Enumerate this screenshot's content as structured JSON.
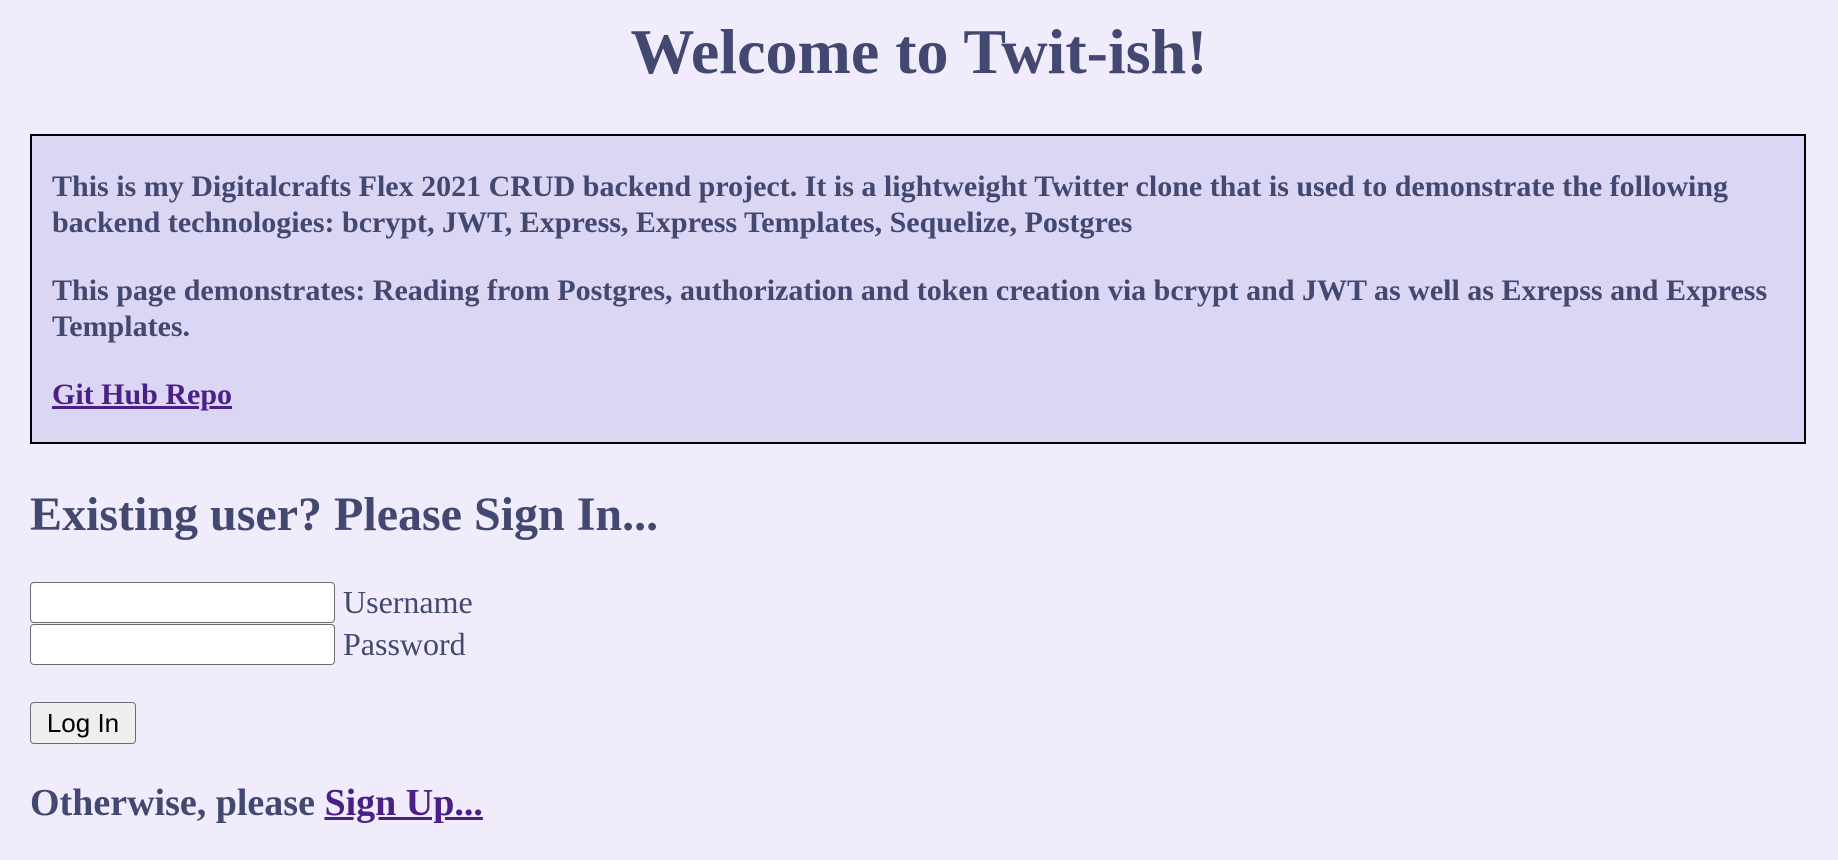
{
  "header": {
    "title": "Welcome to Twit-ish!"
  },
  "intro": {
    "paragraph_1": "This is my Digitalcrafts Flex 2021 CRUD backend project. It is a lightweight Twitter clone that is used to demonstrate the following backend technologies: bcrypt, JWT, Express, Express Templates, Sequelize, Postgres",
    "paragraph_2": "This page demonstrates: Reading from Postgres, authorization and token creation via bcrypt and JWT as well as Exrepss and Express Templates.",
    "repo_link_label": "Git Hub Repo"
  },
  "signin": {
    "heading": "Existing user? Please Sign In...",
    "username_label": "Username",
    "username_value": "",
    "password_label": "Password",
    "password_value": "",
    "login_button_label": "Log In"
  },
  "signup": {
    "prefix_text": "Otherwise, please ",
    "link_label": "Sign Up..."
  },
  "colors": {
    "page_background": "#f1ecfc",
    "text": "#424870",
    "intro_box_background": "#dcd6f5",
    "link": "#4a1f86"
  }
}
